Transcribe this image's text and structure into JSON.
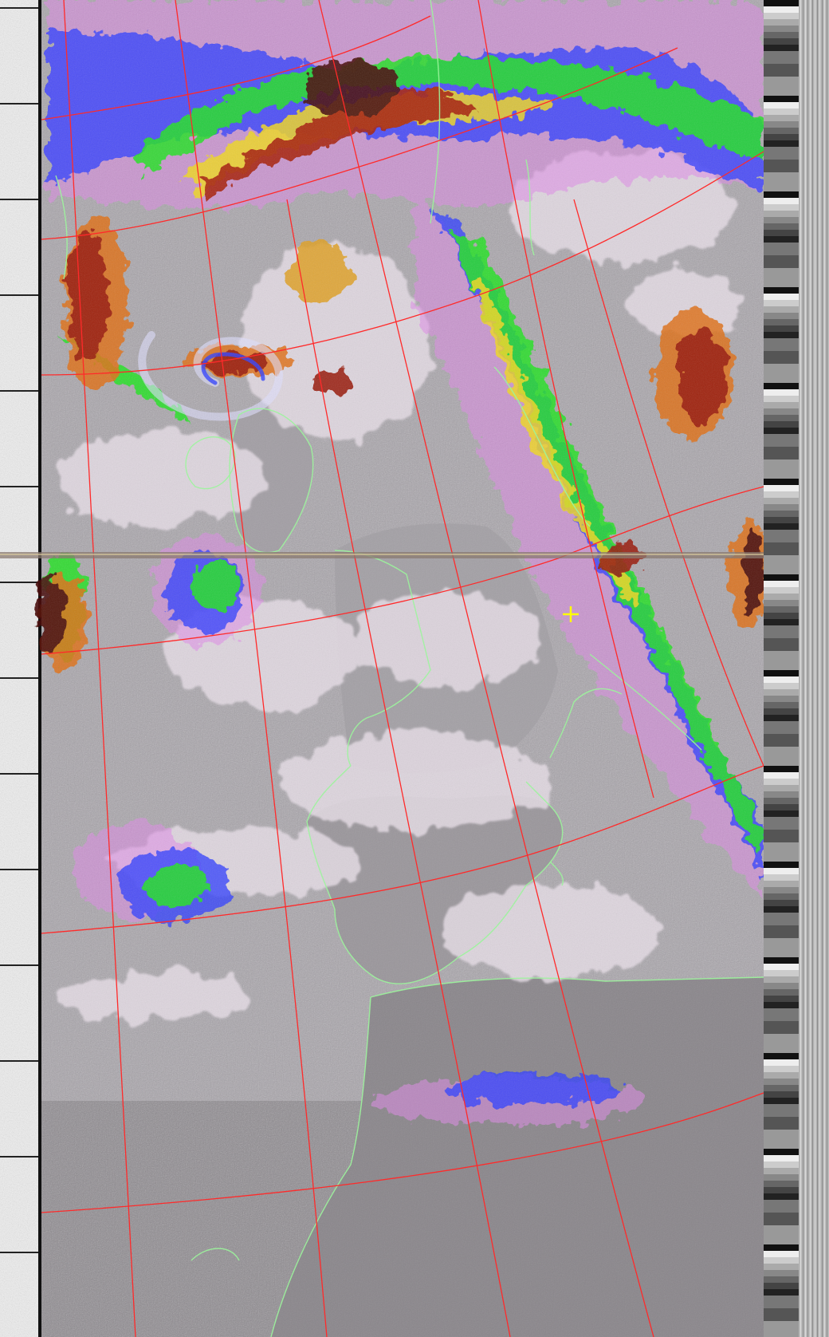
{
  "image": {
    "kind": "NOAA APT weather satellite image (MCIR false color)",
    "colors": {
      "background": "#000000",
      "telemetry_light": "#f4f4f4",
      "cloud_light": "#dcd2dc",
      "land_gray": "#8e8a8e",
      "sea_gray": "#a7a3a9",
      "magenta": "#e000e0",
      "blue": "#2038ff",
      "green": "#20e020",
      "yellow": "#f0e020",
      "orange": "#e07018",
      "red": "#b02010",
      "dark_red": "#4a0e08",
      "grid_red": "#ff2a2a",
      "coast_green": "#9cf59c",
      "marker_yellow": "#ffff00"
    },
    "icons": {
      "marker": "crosshair-plus-icon"
    }
  }
}
